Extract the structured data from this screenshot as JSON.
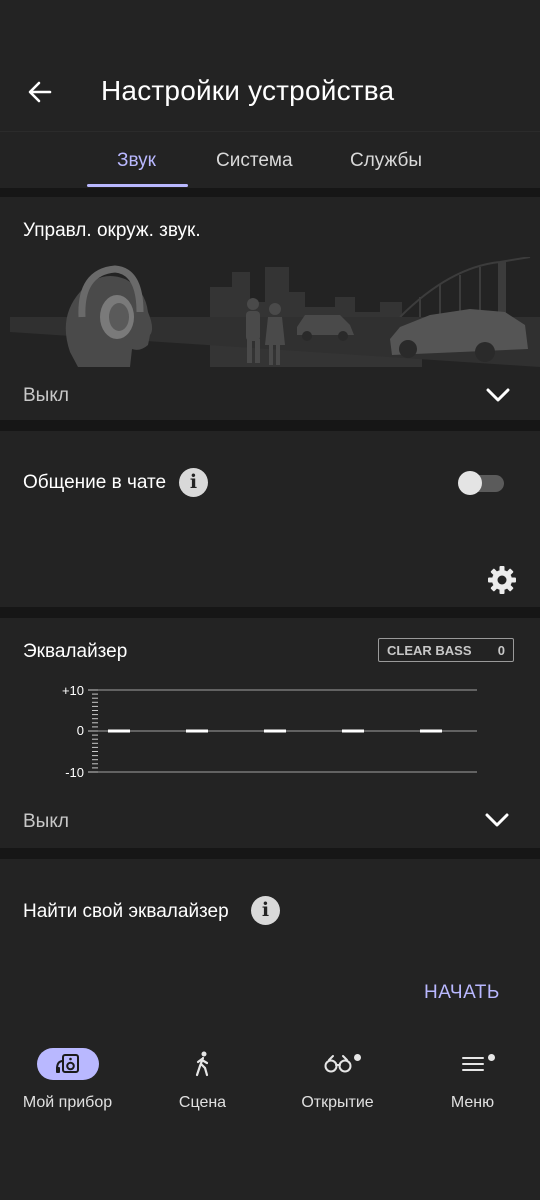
{
  "header": {
    "title": "Настройки устройства",
    "back_icon": "arrow-left-icon"
  },
  "tabs": [
    {
      "label": "Звук",
      "active": true
    },
    {
      "label": "Система",
      "active": false
    },
    {
      "label": "Службы",
      "active": false
    }
  ],
  "ambient_sound": {
    "title": "Управл. окруж. звук.",
    "value": "Выкл"
  },
  "chat": {
    "title": "Общение в чате",
    "toggle_on": false
  },
  "equalizer": {
    "title": "Эквалайзер",
    "clear_bass_label": "CLEAR BASS",
    "clear_bass_value": "0",
    "ticks": [
      "+10",
      "0",
      "-10"
    ],
    "band_levels": [
      0,
      0,
      0,
      0,
      0
    ],
    "value": "Выкл"
  },
  "find_eq": {
    "title": "Найти свой эквалайзер",
    "button": "НАЧАТЬ"
  },
  "bottom_nav": [
    {
      "label": "Мой прибор",
      "icon": "device-icon",
      "active": true
    },
    {
      "label": "Сцена",
      "icon": "walking-person-icon",
      "active": false
    },
    {
      "label": "Открытие",
      "icon": "binoculars-icon",
      "active": false,
      "badge": true
    },
    {
      "label": "Меню",
      "icon": "menu-icon",
      "active": false,
      "badge": true
    }
  ],
  "colors": {
    "accent": "#b9b8ff",
    "card": "#232323",
    "background": "#161616"
  }
}
